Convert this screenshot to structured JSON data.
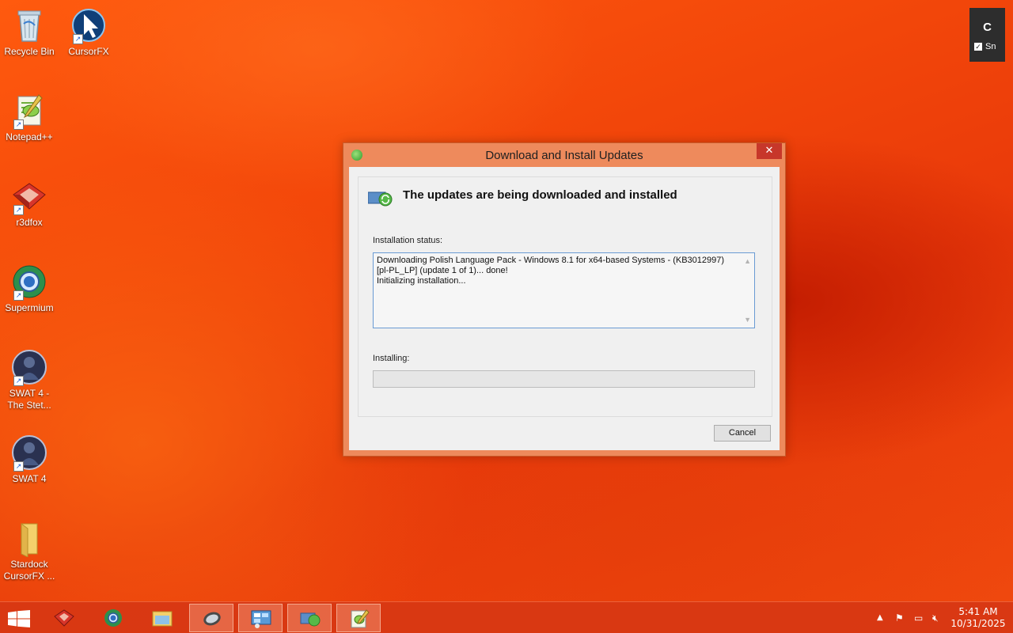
{
  "desktop": {
    "icons": [
      {
        "label": "Recycle Bin",
        "icon": "recycle-bin-icon"
      },
      {
        "label": "CursorFX",
        "icon": "cursorfx-icon"
      },
      {
        "label": "Notepad++",
        "icon": "notepadpp-icon"
      },
      {
        "label": "r3dfox",
        "icon": "r3dfox-icon"
      },
      {
        "label": "Supermium",
        "icon": "supermium-icon"
      },
      {
        "label": "SWAT 4 - The Stet...",
        "icon": "swat4-stetchkov-icon"
      },
      {
        "label": "SWAT 4",
        "icon": "swat4-icon"
      },
      {
        "label": "Stardock CursorFX ...",
        "icon": "folder-icon"
      }
    ]
  },
  "snap_widget": {
    "letter": "C",
    "checkbox_label": "Sn",
    "checked": true
  },
  "dialog": {
    "title": "Download and Install Updates",
    "close_glyph": "✕",
    "heading": "The updates are being downloaded and installed",
    "status_label": "Installation status:",
    "log_lines": [
      "Downloading Polish Language Pack - Windows 8.1 for x64-based Systems - (KB3012997) [pl-PL_LP] (update 1 of 1)... done!",
      "Initializing installation..."
    ],
    "installing_label": "Installing:",
    "progress_fraction": 0.0,
    "cancel_label": "Cancel"
  },
  "taskbar": {
    "items": [
      {
        "name": "start-button",
        "icon": "windows-logo-icon",
        "active": false
      },
      {
        "name": "taskbar-r3dfox",
        "icon": "r3dfox-icon",
        "active": false
      },
      {
        "name": "taskbar-supermium",
        "icon": "supermium-icon",
        "active": false
      },
      {
        "name": "taskbar-file-explorer",
        "icon": "file-explorer-icon",
        "active": false
      },
      {
        "name": "taskbar-disk-utility",
        "icon": "disk-icon",
        "active": true
      },
      {
        "name": "taskbar-control-panel",
        "icon": "control-panel-icon",
        "active": true
      },
      {
        "name": "taskbar-windows-update",
        "icon": "windows-update-icon",
        "active": true
      },
      {
        "name": "taskbar-notepadpp",
        "icon": "notepadpp-icon",
        "active": true
      }
    ],
    "tray": {
      "time": "5:41 AM",
      "date": "10/31/2025"
    }
  },
  "colors": {
    "accent": "#f04a0e",
    "dialog_frame": "#ee8a5c",
    "close_red": "#c7372a"
  }
}
